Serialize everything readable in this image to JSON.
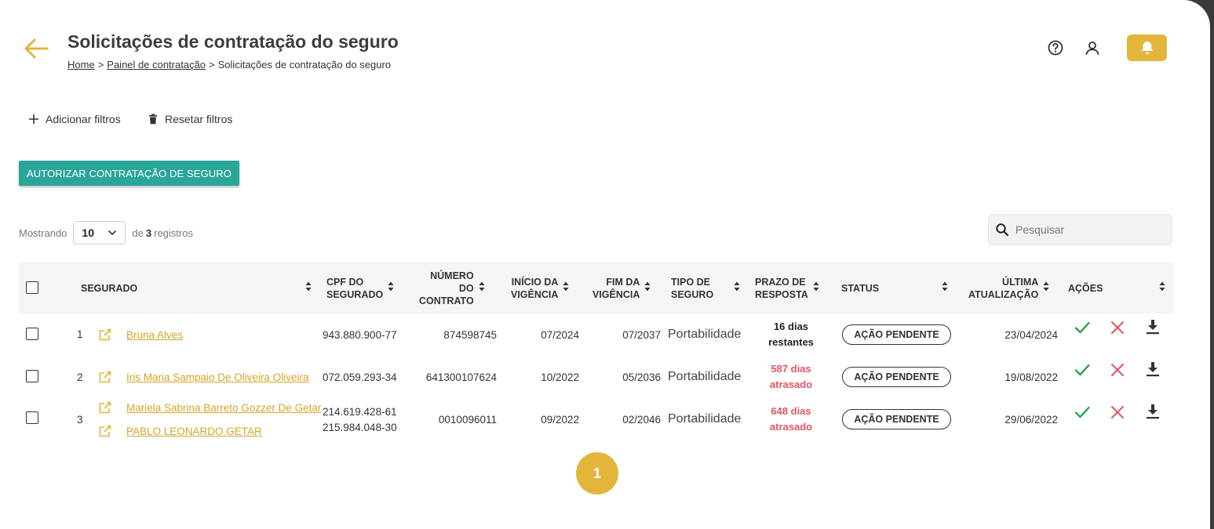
{
  "header": {
    "title": "Solicitações de contratação do seguro",
    "breadcrumb": {
      "home": "Home",
      "sep1": ">",
      "panel": "Painel de contratação",
      "sep2": ">",
      "current": "Solicitações de contratação do seguro"
    }
  },
  "filters": {
    "add": "Adicionar filtros",
    "reset": "Resetar filtros"
  },
  "authorize_button": "AUTORIZAR CONTRATAÇÃO DE SEGURO",
  "listing": {
    "showing": "Mostrando",
    "page_size": "10",
    "of": "de",
    "count": "3",
    "records": "registros"
  },
  "search": {
    "placeholder": "Pesquisar"
  },
  "columns": {
    "segurado": "SEGURADO",
    "cpf": [
      "CPF DO",
      "SEGURADO"
    ],
    "numero": [
      "NÚMERO",
      "DO",
      "CONTRATO"
    ],
    "inicio": [
      "INÍCIO DA",
      "VIGÊNCIA"
    ],
    "fim": [
      "FIM DA",
      "VIGÊNCIA"
    ],
    "tipo": [
      "TIPO DE",
      "SEGURO"
    ],
    "prazo": [
      "PRAZO DE",
      "RESPOSTA"
    ],
    "status": "STATUS",
    "ultima": [
      "ÚLTIMA",
      "ATUALIZAÇÃO"
    ],
    "acoes": "AÇÕES"
  },
  "rows": [
    {
      "index": "1",
      "names": [
        "Bruna Alves"
      ],
      "cpfs": [
        "943.880.900-77"
      ],
      "contract": "874598745",
      "start": "07/2024",
      "end": "07/2037",
      "type": "Portabilidade",
      "deadline": [
        "16 dias",
        "restantes"
      ],
      "status": "AÇÃO PENDENTE",
      "updated": "23/04/2024"
    },
    {
      "index": "2",
      "names": [
        "Iris Maria Sampaio De Oliveira Oliveira"
      ],
      "cpfs": [
        "072.059.293-34"
      ],
      "contract": "641300107624",
      "start": "10/2022",
      "end": "05/2036",
      "type": "Portabilidade",
      "deadline": [
        "587 dias",
        "atrasado"
      ],
      "status": "AÇÃO PENDENTE",
      "updated": "19/08/2022"
    },
    {
      "index": "3",
      "names": [
        "Mariela Sabrina Barreto Gozzer De Getar",
        "PABLO LEONARDO GETAR"
      ],
      "cpfs": [
        "214.619.428-61",
        "215.984.048-30"
      ],
      "contract": "0010096011",
      "start": "09/2022",
      "end": "02/2046",
      "type": "Portabilidade",
      "deadline": [
        "648 dias",
        "atrasado"
      ],
      "status": "AÇÃO PENDENTE",
      "updated": "29/06/2022"
    }
  ],
  "pagination": {
    "current": "1"
  },
  "colors": {
    "accent": "#e3b53b",
    "primary_button": "#2aa59a",
    "late": "#e05565",
    "approve": "#1e9e3e",
    "reject": "#e05565"
  }
}
